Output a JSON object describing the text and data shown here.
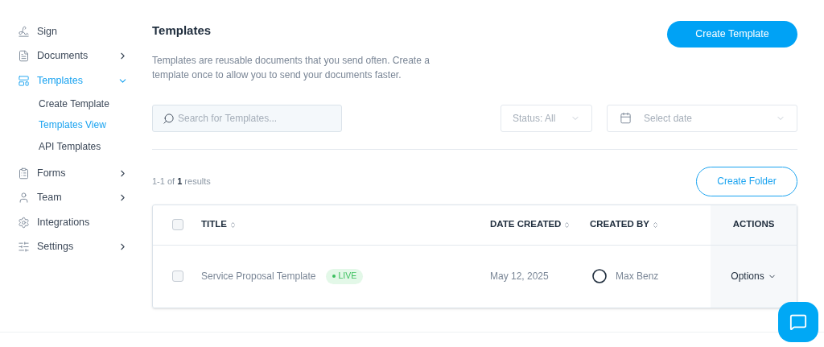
{
  "sidebar": {
    "items": [
      {
        "label": "Sign",
        "selected": false
      },
      {
        "label": "Documents",
        "selected": false,
        "expanded": false
      },
      {
        "label": "Templates",
        "selected": true,
        "expanded": true,
        "children": [
          {
            "label": "Create Template",
            "selected": false
          },
          {
            "label": "Templates View",
            "selected": true
          },
          {
            "label": "API Templates",
            "selected": false
          }
        ]
      },
      {
        "label": "Forms",
        "selected": false,
        "expanded": false
      },
      {
        "label": "Team",
        "selected": false,
        "expanded": false
      },
      {
        "label": "Integrations",
        "selected": false
      },
      {
        "label": "Settings",
        "selected": false,
        "expanded": false
      }
    ]
  },
  "header": {
    "title": "Templates",
    "description": "Templates are reusable documents that you send often. Create a template once to allow you to send your documents faster.",
    "create_button": "Create Template"
  },
  "filters": {
    "search": {
      "placeholder": "Search for Templates..."
    },
    "status": {
      "value": "Status: All"
    },
    "date": {
      "placeholder": "Select date"
    }
  },
  "results": {
    "text": "1-1 of **1** results",
    "create_folder_button": "Create Folder"
  },
  "table": {
    "header_checked": false,
    "columns": [
      {
        "label": "TITLE",
        "sortable": true
      },
      {
        "label": "DATE CREATED",
        "sortable": true
      },
      {
        "label": "CREATED BY",
        "sortable": true
      },
      {
        "label": "ACTIONS",
        "sortable": false
      }
    ],
    "rows": [
      {
        "checked": false,
        "title": "Service Proposal Template",
        "status": "LIVE",
        "date_created": "May 12, 2025",
        "created_by": "Max Benz",
        "actions": "Options"
      }
    ]
  }
}
